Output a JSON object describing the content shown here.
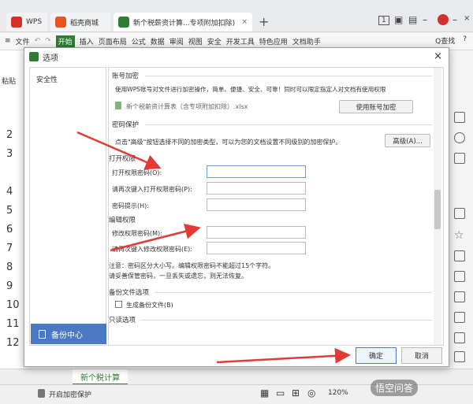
{
  "window": {
    "tabs": [
      {
        "label": "WPS",
        "color": "#d93025"
      },
      {
        "label": "稻壳商城",
        "color": "#e8541e"
      },
      {
        "label": "新个税薪资计算...专项附加扣除)",
        "color": "#2e7d32"
      }
    ],
    "add_tab": "+",
    "controls": {
      "minimize": "–",
      "maximize": "□",
      "close": "×"
    },
    "badge": "1"
  },
  "menubar": {
    "items": [
      "文件",
      "开始",
      "插入",
      "页面布局",
      "公式",
      "数据",
      "审阅",
      "视图",
      "安全",
      "开发工具",
      "特色应用",
      "文档助手"
    ],
    "active": "开始",
    "search": "Q查找",
    "help": "?"
  },
  "sheet": {
    "row_numbers": [
      "2",
      "3",
      "4",
      "5",
      "6",
      "7",
      "8",
      "9",
      "10",
      "11",
      "12"
    ],
    "sheet_tab": "新个税计算",
    "status_protect": "开启加密保护",
    "zoom": "120%",
    "left_label": "粘贴"
  },
  "dialog": {
    "title": "选项",
    "close": "×",
    "nav_item": "安全性",
    "backup_button": "备份中心",
    "sections": {
      "account_encrypt": {
        "title": "账号加密",
        "desc": "使用WPS账号对文件进行加密操作，简单、便捷、安全、可靠！同时可以限定指定人对文档有使用权限",
        "file": "新个税薪资计算表（含专项附加扣除）.xlsx",
        "button": "使用账号加密"
      },
      "password": {
        "title": "密码保护",
        "desc": "点击\"高级\"按钮选择不同的加密类型，可以为您的文档设置不同级别的加密保护。",
        "advanced_button": "高级(A)...",
        "open_title": "打开权限",
        "open_pwd": "打开权限密码(O):",
        "open_pwd_confirm": "请再次键入打开权限密码(P):",
        "hint": "密码提示(H):",
        "edit_title": "编辑权限",
        "edit_pwd": "修改权限密码(M):",
        "edit_pwd_confirm": "请再次键入修改权限密码(E):",
        "note1": "注意：密码区分大小写。编辑权限密码不能超过15个字符。",
        "note2": "请妥善保管密码，一旦丢失或遗忘，则无法恢复。"
      },
      "backup": {
        "title": "备份文件选项",
        "checkbox": "生成备份文件(B)"
      },
      "readonly": {
        "title": "只读选项"
      }
    },
    "ok": "确定",
    "cancel": "取消"
  },
  "watermark": "悟空问答",
  "colors": {
    "accent": "#2e7d32",
    "arrow": "#e53935",
    "backup": "#4a78c2"
  }
}
